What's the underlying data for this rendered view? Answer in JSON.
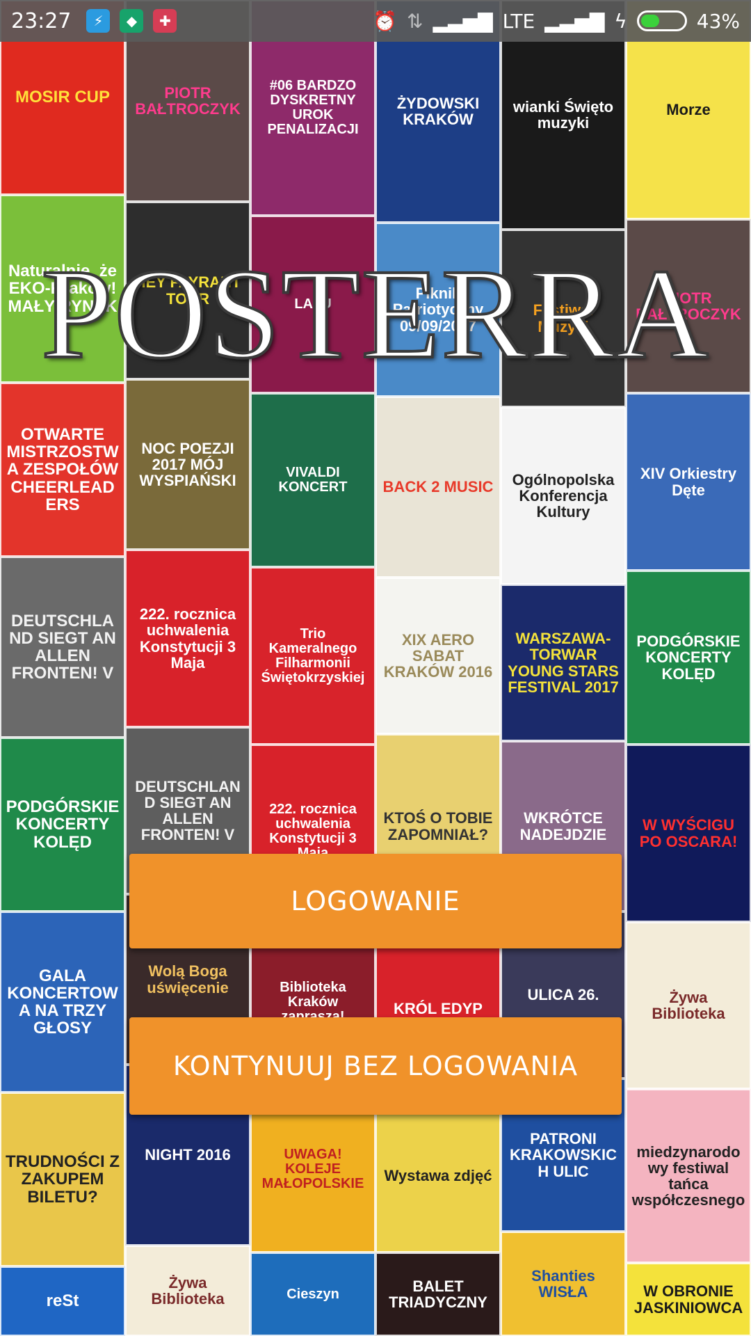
{
  "status_bar": {
    "time": "23:27",
    "network": "LTE",
    "battery_percent": "43%",
    "battery_level": 0.43,
    "notification_icons": [
      "usb-icon",
      "shield-icon",
      "huawei-health-icon"
    ],
    "notification_colors": [
      "#2b9be0",
      "#17a36b",
      "#d63d55"
    ]
  },
  "app": {
    "title": "POSTERRA"
  },
  "buttons": {
    "login_label": "LOGOWANIE",
    "guest_label": "KONTYNUUJ BEZ LOGOWANIA",
    "color": "#f0922a"
  },
  "posters": [
    [
      {
        "text": "MOSIR CUP",
        "bg": "#e02a1f",
        "fg": "#ffe03a"
      },
      {
        "text": "Naturalnie, że EKO-Kraków! MAŁY RYNEK",
        "bg": "#7bbf3a",
        "fg": "#ffffff"
      },
      {
        "text": "OTWARTE MISTRZOSTWA ZESPOŁÓW CHEERLEADERS",
        "bg": "#e3342b",
        "fg": "#ffffff"
      },
      {
        "text": "DEUTSCHLAND SIEGT AN ALLEN FRONTEN! V",
        "bg": "#6a6a6a",
        "fg": "#f2f2f2"
      },
      {
        "text": "PODGÓRSKIE KONCERTY KOLĘD",
        "bg": "#1f8a4a",
        "fg": "#ffffff"
      },
      {
        "text": "GALA KONCERTOWA NA TRZY GŁOSY",
        "bg": "#2c64b8",
        "fg": "#ffffff"
      },
      {
        "text": "TRUDNOŚCI Z ZAKUPEM BILETU?",
        "bg": "#e9c64a",
        "fg": "#222222"
      },
      {
        "text": "reSt",
        "bg": "#1f66c4",
        "fg": "#ffffff"
      }
    ],
    [
      {
        "text": "PIOTR BAŁTROCZYK",
        "bg": "#5b4a48",
        "fg": "#ff3b8d"
      },
      {
        "text": "HEY FAYRANT TOUR",
        "bg": "#2d2d2d",
        "fg": "#f4e23b"
      },
      {
        "text": "NOC POEZJI 2017 MÓJ WYSPIAŃSKI",
        "bg": "#7a6a3a",
        "fg": "#ffffff"
      },
      {
        "text": "222. rocznica uchwalenia Konstytucji 3 Maja",
        "bg": "#d8222a",
        "fg": "#ffffff"
      },
      {
        "text": "DEUTSCHLAND SIEGT AN ALLEN FRONTEN! V",
        "bg": "#5e5e5e",
        "fg": "#f2f2f2"
      },
      {
        "text": "Wolą Boga uświęcenie",
        "bg": "#3a2a2a",
        "fg": "#f0c060"
      },
      {
        "text": "NIGHT 2016",
        "bg": "#1a2a6a",
        "fg": "#ffffff"
      },
      {
        "text": "Żywa Biblioteka",
        "bg": "#f3ecd9",
        "fg": "#7a2a2a"
      }
    ],
    [
      {
        "text": "#06 BARDZO DYSKRETNY UROK PENALIZACJI",
        "bg": "#8e2a6a",
        "fg": "#ffffff"
      },
      {
        "text": "LAZU",
        "bg": "#8a1a4a",
        "fg": "#ffffff"
      },
      {
        "text": "VIVALDI KONCERT",
        "bg": "#1e6e4a",
        "fg": "#ffffff"
      },
      {
        "text": "Trio Kameralnego Filharmonii Świętokrzyskiej",
        "bg": "#d8232b",
        "fg": "#ffffff"
      },
      {
        "text": "222. rocznica uchwalenia Konstytucji 3 Maja",
        "bg": "#d8222a",
        "fg": "#ffffff"
      },
      {
        "text": "Biblioteka Kraków zaprasza!",
        "bg": "#8b1d2a",
        "fg": "#ffffff"
      },
      {
        "text": "UWAGA! KOLEJE MAŁOPOLSKIE",
        "bg": "#f0b020",
        "fg": "#c02020"
      },
      {
        "text": "Cieszyn",
        "bg": "#1e6dbb",
        "fg": "#ffffff"
      }
    ],
    [
      {
        "text": "ŻYDOWSKI KRAKÓW",
        "bg": "#1d3e86",
        "fg": "#ffffff"
      },
      {
        "text": "Piknik Patriotyczny 09/09/2017",
        "bg": "#4a8ac8",
        "fg": "#ffffff"
      },
      {
        "text": "BACK 2 MUSIC",
        "bg": "#e9e4d6",
        "fg": "#e83a2a"
      },
      {
        "text": "XIX AERO SABAT KRAKÓW 2016",
        "bg": "#f4f4f0",
        "fg": "#9a8a5a"
      },
      {
        "text": "KTOŚ O TOBIE ZAPOMNIAŁ?",
        "bg": "#e8d070",
        "fg": "#333333"
      },
      {
        "text": "KRÓL EDYP",
        "bg": "#d8222a",
        "fg": "#ffffff"
      },
      {
        "text": "Wystawa zdjęć",
        "bg": "#ecd24a",
        "fg": "#222222"
      },
      {
        "text": "BALET TRIADYCZNY",
        "bg": "#2a1a1a",
        "fg": "#ffffff"
      }
    ],
    [
      {
        "text": "wianki Święto muzyki",
        "bg": "#1a1a1a",
        "fg": "#ffffff"
      },
      {
        "text": "Festiwal Muzyki",
        "bg": "#333333",
        "fg": "#f4a020"
      },
      {
        "text": "Ogólnopolska Konferencja Kultury",
        "bg": "#f4f4f4",
        "fg": "#222222"
      },
      {
        "text": "WARSZAWA-TORWAR YOUNG STARS FESTIVAL 2017",
        "bg": "#1b2a6b",
        "fg": "#f4e23b"
      },
      {
        "text": "WKRÓTCE NADEJDZIE",
        "bg": "#8a6a8a",
        "fg": "#ffffff"
      },
      {
        "text": "ULICA 26.",
        "bg": "#3a3a5a",
        "fg": "#ffffff"
      },
      {
        "text": "PATRONI KRAKOWSKICH ULIC",
        "bg": "#1f4fa0",
        "fg": "#ffffff"
      },
      {
        "text": "Shanties WISŁA",
        "bg": "#f0c030",
        "fg": "#1f4fa0"
      }
    ],
    [
      {
        "text": "Morze",
        "bg": "#f5e24a",
        "fg": "#1a1a1a"
      },
      {
        "text": "PIOTR BAŁTROCZYK",
        "bg": "#5b4a48",
        "fg": "#ff3b8d"
      },
      {
        "text": "XIV Orkiestry Dęte",
        "bg": "#3a6ab8",
        "fg": "#ffffff"
      },
      {
        "text": "PODGÓRSKIE KONCERTY KOLĘD",
        "bg": "#1f8a4a",
        "fg": "#ffffff"
      },
      {
        "text": "W WYŚCIGU PO OSCARA!",
        "bg": "#101a5a",
        "fg": "#ff3030"
      },
      {
        "text": "Żywa Biblioteka",
        "bg": "#f3ecd9",
        "fg": "#7a2a2a"
      },
      {
        "text": "miedzynarodowy festiwal tańca współczesnego",
        "bg": "#f4b4c0",
        "fg": "#222222"
      },
      {
        "text": "W OBRONIE JASKINIOWCA",
        "bg": "#f4e23b",
        "fg": "#1a1a1a"
      }
    ]
  ]
}
